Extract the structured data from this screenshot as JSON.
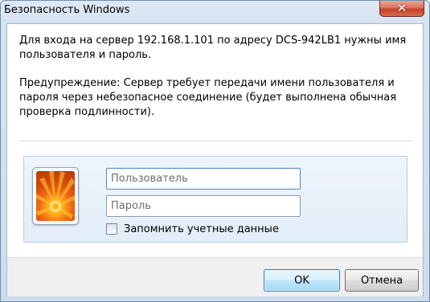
{
  "window": {
    "title": "Безопасность Windows"
  },
  "icons": {
    "close": "close-icon",
    "avatar": "user-picture-flower"
  },
  "message": {
    "line1": "Для входа на сервер 192.168.1.101 по адресу DCS-942LB1 нужны имя пользователя и пароль.",
    "warning": "Предупреждение: Сервер требует передачи имени пользователя и пароля через небезопасное соединение (будет выполнена обычная проверка подлинности)."
  },
  "credentials": {
    "username_placeholder": "Пользователь",
    "username_value": "",
    "password_placeholder": "Пароль",
    "password_value": "",
    "remember_label": "Запомнить учетные данные",
    "remember_checked": false
  },
  "buttons": {
    "ok_label": "OK",
    "cancel_label": "Отмена"
  },
  "colors": {
    "close_button": "#c4402a",
    "default_button_border": "#3c7fb1",
    "focus_border": "#4d86c8"
  }
}
